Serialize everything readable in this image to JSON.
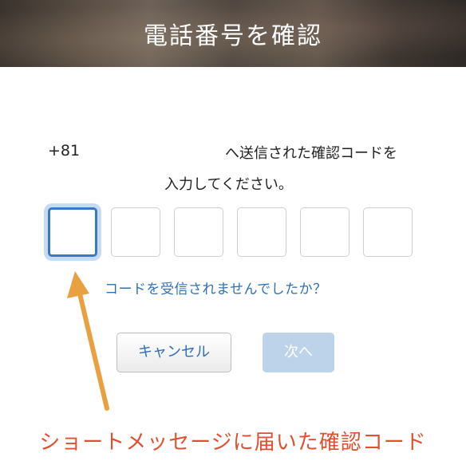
{
  "header": {
    "title": "電話番号を確認"
  },
  "form": {
    "phone_prefix": "+81",
    "instruction_line1": "へ送信された確認コードを",
    "instruction_line2": "入力してください。",
    "code_digits": [
      "",
      "",
      "",
      "",
      "",
      ""
    ]
  },
  "links": {
    "resend": "コードを受信されませんでしたか？"
  },
  "buttons": {
    "cancel": "キャンセル",
    "next": "次へ"
  },
  "annotation": {
    "caption": "ショートメッセージに届いた確認コード",
    "arrow_color": "#e8a040",
    "caption_color": "#e05030"
  },
  "colors": {
    "link": "#2f6fb6",
    "active_border": "#3b78c0",
    "next_disabled": "#bcd3ea"
  }
}
